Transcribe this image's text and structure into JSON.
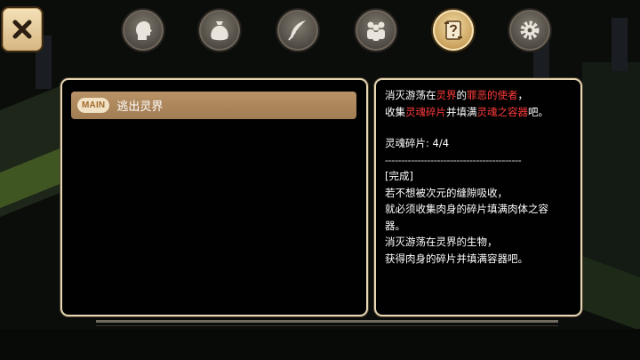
{
  "top_bar": {
    "close_icon": "close-x-icon",
    "tabs": [
      {
        "icon": "head-profile-icon",
        "active": false
      },
      {
        "icon": "bag-icon",
        "active": false
      },
      {
        "icon": "feather-skill-icon",
        "active": false
      },
      {
        "icon": "party-icon",
        "active": false
      },
      {
        "icon": "quest-scroll-icon",
        "active": true
      },
      {
        "icon": "gear-icon",
        "active": false
      }
    ]
  },
  "quest_list": {
    "items": [
      {
        "badge": "MAIN",
        "title": "逃出灵界"
      }
    ]
  },
  "quest_detail": {
    "line1": {
      "a": "消灭游荡在",
      "b": "灵界",
      "c": "的",
      "d": "罪恶的使者",
      "e": "，"
    },
    "line2": {
      "a": "收集",
      "b": "灵魂碎片",
      "c": "并填满",
      "d": "灵魂之容器",
      "e": "吧。"
    },
    "progress": "灵魂碎片: 4/4",
    "divider": "------------------------------------------",
    "status": "[完成]",
    "desc": [
      "若不想被次元的缝隙吸收，",
      "就必须收集肉身的碎片填满肉体之容",
      "器。",
      "消灭游荡在灵界的生物，",
      "获得肉身的碎片并填满容器吧。"
    ]
  },
  "colors": {
    "highlight_red": "#ff3b3b",
    "panel_border": "#e7d7b4",
    "accent_gold": "#c79d57"
  }
}
